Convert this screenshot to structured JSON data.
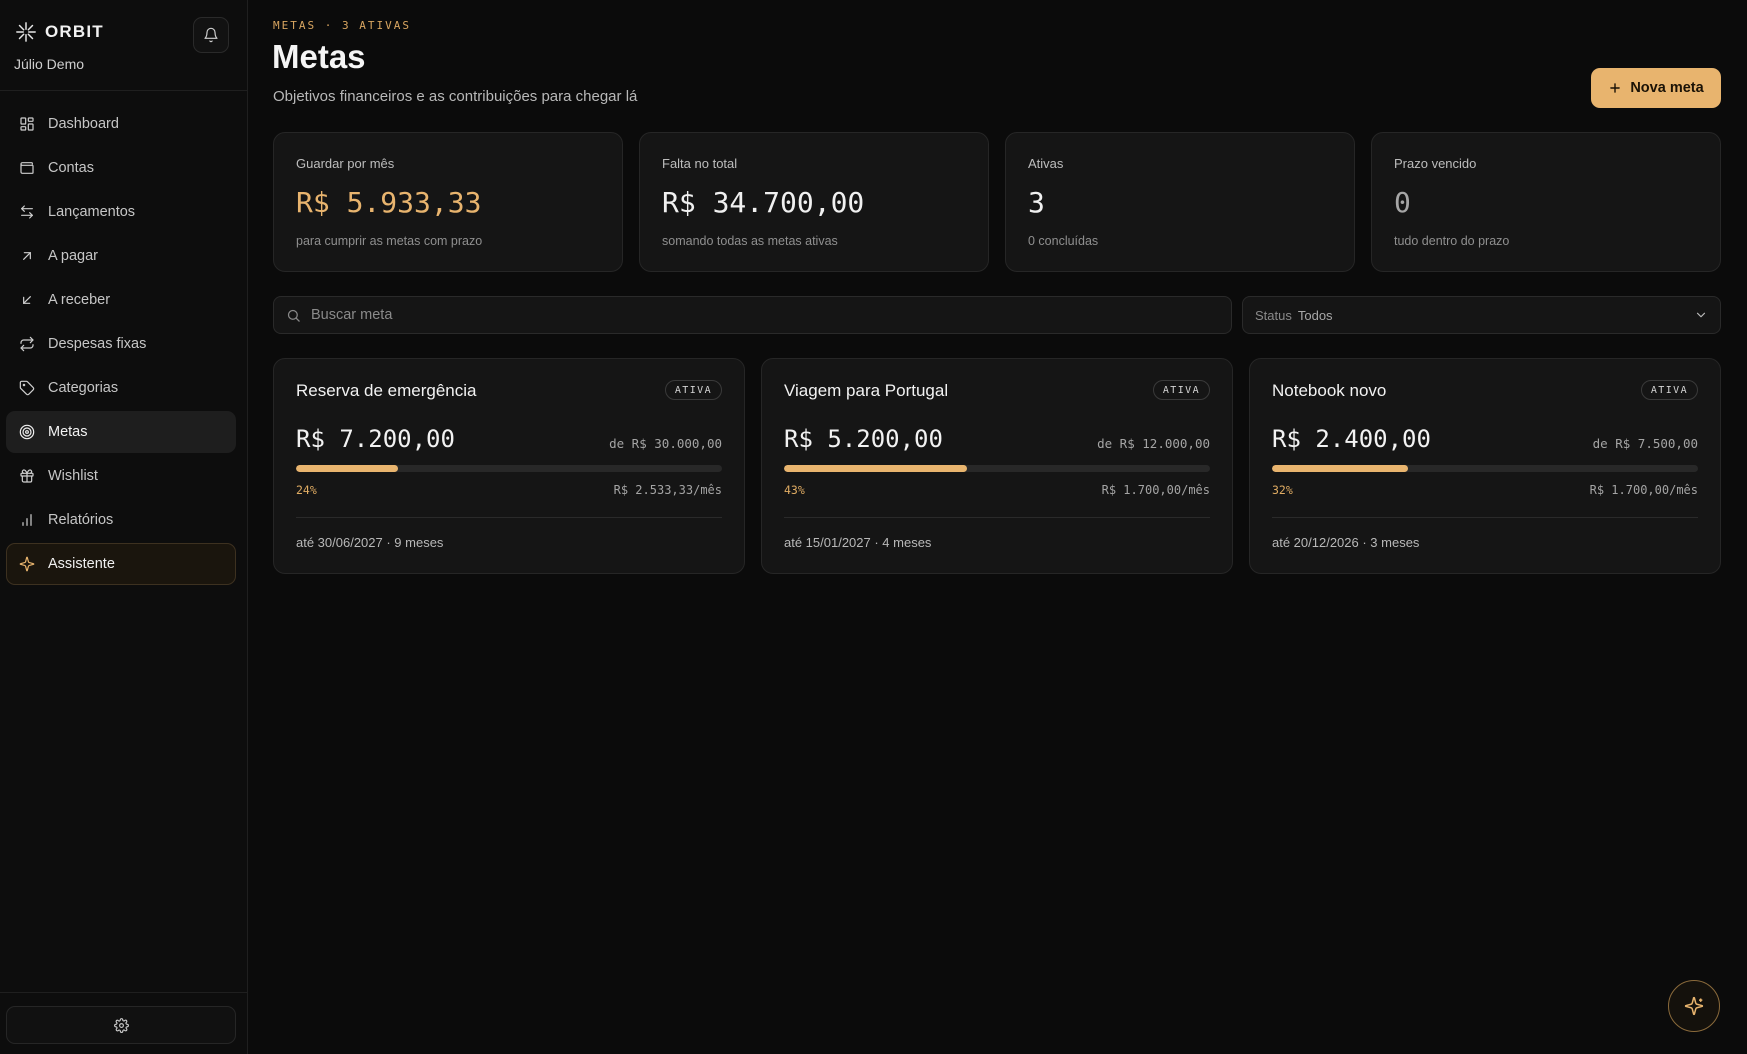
{
  "app": {
    "name": "ORBIT",
    "user": "Júlio Demo"
  },
  "nav": [
    {
      "label": "Dashboard",
      "icon": "grid-icon"
    },
    {
      "label": "Contas",
      "icon": "wallet-icon"
    },
    {
      "label": "Lançamentos",
      "icon": "arrows-left-right-icon"
    },
    {
      "label": "A pagar",
      "icon": "arrow-up-right-icon"
    },
    {
      "label": "A receber",
      "icon": "arrow-down-left-icon"
    },
    {
      "label": "Despesas fixas",
      "icon": "repeat-icon"
    },
    {
      "label": "Categorias",
      "icon": "tag-icon"
    },
    {
      "label": "Metas",
      "icon": "target-icon",
      "active": true
    },
    {
      "label": "Wishlist",
      "icon": "gift-icon"
    },
    {
      "label": "Relatórios",
      "icon": "bar-chart-icon"
    },
    {
      "label": "Assistente",
      "icon": "sparkles-icon",
      "highlight": true
    }
  ],
  "header": {
    "eyebrow": "METAS · 3 ATIVAS",
    "title": "Metas",
    "subtitle": "Objetivos financeiros e as contribuições para chegar lá",
    "new_button": "Nova meta"
  },
  "stats": [
    {
      "label": "Guardar por mês",
      "value": "R$ 5.933,33",
      "note": "para cumprir as metas com prazo",
      "tone": "accent"
    },
    {
      "label": "Falta no total",
      "value": "R$ 34.700,00",
      "note": "somando todas as metas ativas",
      "tone": "normal"
    },
    {
      "label": "Ativas",
      "value": "3",
      "note": "0 concluídas",
      "tone": "normal"
    },
    {
      "label": "Prazo vencido",
      "value": "0",
      "note": "tudo dentro do prazo",
      "tone": "muted"
    }
  ],
  "filters": {
    "search_placeholder": "Buscar meta",
    "status_label": "Status",
    "status_value": "Todos"
  },
  "goals": [
    {
      "name": "Reserva de emergência",
      "badge": "ATIVA",
      "amount": "R$ 7.200,00",
      "target": "de R$ 30.000,00",
      "progress": 24,
      "percent": "24%",
      "monthly": "R$ 2.533,33/mês",
      "due": "até 30/06/2027 · 9 meses"
    },
    {
      "name": "Viagem para Portugal",
      "badge": "ATIVA",
      "amount": "R$ 5.200,00",
      "target": "de R$ 12.000,00",
      "progress": 43,
      "percent": "43%",
      "monthly": "R$ 1.700,00/mês",
      "due": "até 15/01/2027 · 4 meses"
    },
    {
      "name": "Notebook novo",
      "badge": "ATIVA",
      "amount": "R$ 2.400,00",
      "target": "de R$ 7.500,00",
      "progress": 32,
      "percent": "32%",
      "monthly": "R$ 1.700,00/mês",
      "due": "até 20/12/2026 · 3 meses"
    }
  ],
  "colors": {
    "accent": "#e8b46e",
    "background": "#0b0b0b",
    "card": "#151515"
  }
}
